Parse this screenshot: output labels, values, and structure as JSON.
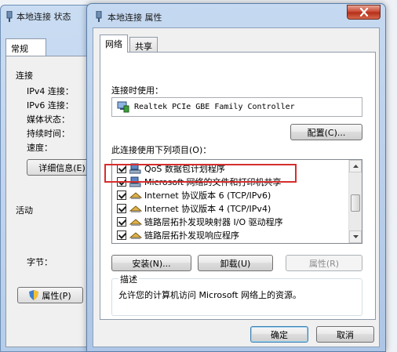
{
  "background_window": {
    "title": "本地连接 状态",
    "tab": "常规",
    "sections": [
      "连接",
      "活动"
    ],
    "fields": [
      "IPv4 连接：",
      "IPv6 连接：",
      "媒体状态：",
      "持续时间：",
      "速度："
    ],
    "bytes_label": "字节：",
    "details_button": "详细信息(E)",
    "properties_button": "属性(P)"
  },
  "dialog": {
    "title": "本地连接 属性",
    "tabs": [
      "网络",
      "共享"
    ],
    "connect_using_label": "连接时使用：",
    "adapter": "Realtek PCIe GBE Family Controller",
    "configure_button": "配置(C)...",
    "items_label": "此连接使用下列项目(O)：",
    "items": [
      {
        "label": "QoS 数据包计划程序",
        "icon": "network-service-icon",
        "checked": true
      },
      {
        "label": "Microsoft 网络的文件和打印机共享",
        "icon": "network-service-icon",
        "checked": true
      },
      {
        "label": "Internet 协议版本 6 (TCP/IPv6)",
        "icon": "protocol-icon",
        "checked": true
      },
      {
        "label": "Internet 协议版本 4 (TCP/IPv4)",
        "icon": "protocol-icon",
        "checked": true
      },
      {
        "label": "链路层拓扑发现映射器 I/O 驱动程序",
        "icon": "protocol-icon",
        "checked": true
      },
      {
        "label": "链路层拓扑发现响应程序",
        "icon": "protocol-icon",
        "checked": true
      }
    ],
    "install_button": "安装(N)...",
    "uninstall_button": "卸载(U)",
    "properties_button": "属性(R)",
    "description_title": "描述",
    "description": "允许您的计算机访问 Microsoft 网络上的资源。",
    "ok_button": "确定",
    "cancel_button": "取消"
  },
  "colors": {
    "highlight_border": "#d62e2e"
  }
}
